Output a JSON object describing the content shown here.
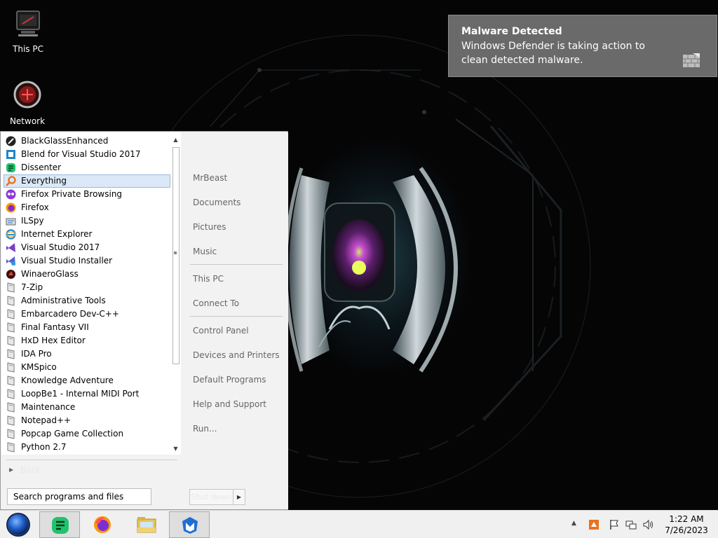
{
  "desktop": {
    "icons": [
      {
        "label": "This PC",
        "icon": "this-pc-icon"
      },
      {
        "label": "Network",
        "icon": "network-icon"
      }
    ]
  },
  "toast": {
    "title": "Malware Detected",
    "body": "Windows Defender is taking action to clean detected malware.",
    "icon": "defender-wall-icon"
  },
  "start_menu": {
    "programs": [
      {
        "label": "BlackGlassEnhanced",
        "icon": "blackglass-icon",
        "selected": false
      },
      {
        "label": "Blend for Visual Studio 2017",
        "icon": "blend-icon",
        "selected": false
      },
      {
        "label": "Dissenter",
        "icon": "dissenter-icon",
        "selected": false
      },
      {
        "label": "Everything",
        "icon": "everything-search-icon",
        "selected": true
      },
      {
        "label": "Firefox Private Browsing",
        "icon": "firefox-private-icon",
        "selected": false
      },
      {
        "label": "Firefox",
        "icon": "firefox-icon",
        "selected": false
      },
      {
        "label": "ILSpy",
        "icon": "ilspy-icon",
        "selected": false
      },
      {
        "label": "Internet Explorer",
        "icon": "internet-explorer-icon",
        "selected": false
      },
      {
        "label": "Visual Studio 2017",
        "icon": "visual-studio-icon",
        "selected": false
      },
      {
        "label": "Visual Studio Installer",
        "icon": "vs-installer-icon",
        "selected": false
      },
      {
        "label": "WinaeroGlass",
        "icon": "winaeroglass-icon",
        "selected": false
      },
      {
        "label": "7-Zip",
        "icon": "folder-icon",
        "selected": false
      },
      {
        "label": "Administrative Tools",
        "icon": "folder-icon",
        "selected": false
      },
      {
        "label": "Embarcadero Dev-C++",
        "icon": "folder-icon",
        "selected": false
      },
      {
        "label": "Final Fantasy VII",
        "icon": "folder-icon",
        "selected": false
      },
      {
        "label": "HxD Hex Editor",
        "icon": "folder-icon",
        "selected": false
      },
      {
        "label": "IDA Pro",
        "icon": "folder-icon",
        "selected": false
      },
      {
        "label": "KMSpico",
        "icon": "folder-icon",
        "selected": false
      },
      {
        "label": "Knowledge Adventure",
        "icon": "folder-icon",
        "selected": false
      },
      {
        "label": "LoopBe1 - Internal MIDI Port",
        "icon": "folder-icon",
        "selected": false
      },
      {
        "label": "Maintenance",
        "icon": "folder-icon",
        "selected": false
      },
      {
        "label": "Notepad++",
        "icon": "folder-icon",
        "selected": false
      },
      {
        "label": "Popcap Game Collection",
        "icon": "folder-icon",
        "selected": false
      },
      {
        "label": "Python 2.7",
        "icon": "folder-icon",
        "selected": false
      }
    ],
    "all_programs_label": "Back",
    "search_placeholder": "Search programs and files",
    "right_pane": [
      {
        "label": "MrBeast"
      },
      {
        "label": "Documents"
      },
      {
        "label": "Pictures"
      },
      {
        "label": "Music"
      },
      {
        "label": "This PC"
      },
      {
        "label": "Connect To"
      },
      {
        "label": "Control Panel"
      },
      {
        "label": "Devices and Printers"
      },
      {
        "label": "Default Programs"
      },
      {
        "label": "Help and Support"
      },
      {
        "label": "Run..."
      }
    ],
    "shutdown_label": "Shut down"
  },
  "taskbar": {
    "pinned": [
      {
        "icon": "dissenter-icon",
        "active": true
      },
      {
        "icon": "firefox-icon",
        "active": false
      },
      {
        "icon": "file-explorer-icon",
        "active": false
      },
      {
        "icon": "malwarebytes-icon",
        "active": true
      }
    ],
    "tray_icons": [
      "show-hidden-icons-chevron-icon",
      "security-shield-icon",
      "action-center-flag-icon",
      "network-icon",
      "volume-icon"
    ],
    "time": "1:22 AM",
    "date": "7/26/2023"
  }
}
